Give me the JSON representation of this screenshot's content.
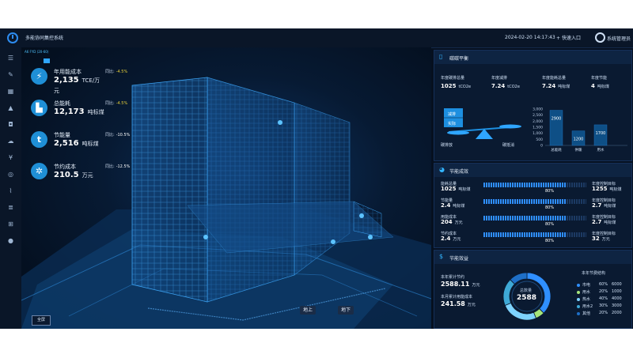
{
  "app": {
    "title": "多能协同集控系统",
    "datetime": "2024-02-20 14:17:43",
    "quick_entry": "快速入口",
    "admin": "系统管理员"
  },
  "sidebar": {
    "icons": [
      "menu-icon",
      "edit-icon",
      "grid-icon",
      "alert-icon",
      "box-icon",
      "cloud-icon",
      "yen-icon",
      "target-icon",
      "chart-line-icon",
      "settings-icon",
      "windows-icon",
      "user-icon"
    ]
  },
  "scene": {
    "floor_tag": "A6 FYD (20-60)",
    "fullscreen_label": "全屏",
    "above_ground_label": "地上",
    "below_ground_label": "地下"
  },
  "stats": [
    {
      "icon": "lightning-icon",
      "glyph": "⚡",
      "label": "年用能成本",
      "value": "2,135",
      "unit": "TCE/万",
      "unit2": "元",
      "ratio_label": "同比:",
      "ratio": "-4.5%",
      "ratio_color": "#e6cf3a"
    },
    {
      "icon": "factory-icon",
      "glyph": "▙",
      "label": "总能耗",
      "value": "12,173",
      "unit": "吨标煤",
      "unit2": "",
      "ratio_label": "同比:",
      "ratio": "-4.5%",
      "ratio_color": "#e6cf3a"
    },
    {
      "icon": "leaf-icon",
      "glyph": "t",
      "label": "节能量",
      "value": "2,516",
      "unit": "吨标煤",
      "unit2": "",
      "ratio_label": "同比:",
      "ratio": "-10.5%",
      "ratio_color": "#ffffff"
    },
    {
      "icon": "snowflake-icon",
      "glyph": "✲",
      "label": "节约成本",
      "value": "210.5",
      "unit": "万元",
      "unit2": "",
      "ratio_label": "同比:",
      "ratio": "-12.5%",
      "ratio_color": "#ffffff"
    }
  ],
  "carbon_panel": {
    "title": "碳碳平衡",
    "metrics": [
      {
        "label": "年度碳排总量",
        "value": "1025",
        "unit": "tCO2e"
      },
      {
        "label": "年度减排",
        "value": "7.24",
        "unit": "tCO2e"
      },
      {
        "label": "年度能耗总量",
        "value": "7.24",
        "unit": "吨标煤"
      },
      {
        "label": "年度节能",
        "value": "4",
        "unit": "吨标煤"
      }
    ],
    "balance": {
      "box_top": "减排",
      "box_bottom": "实际",
      "left_label": "碳排放",
      "right_label": "碳抵消"
    },
    "chart_data": {
      "type": "bar",
      "categories": [
        "总能耗",
        "供暖",
        "用水"
      ],
      "values": [
        2900,
        1200,
        1700
      ],
      "ylim": [
        0,
        3000
      ],
      "yticks": [
        "3,000",
        "2,500",
        "2,000",
        "1,500",
        "1,000",
        "500",
        "0"
      ],
      "bar_color": "#0e4f86"
    }
  },
  "saving_panel": {
    "title": "节能成效",
    "rows": [
      {
        "label": "能耗总量",
        "value": "1025",
        "unit": "吨标煤",
        "percent": "80%",
        "fill": 0.8,
        "target_label": "年度控制目标",
        "target_value": "1255",
        "target_unit": "吨标煤"
      },
      {
        "label": "节能量",
        "value": "2.4",
        "unit": "吨标煤",
        "percent": "80%",
        "fill": 0.8,
        "target_label": "年度控制目标",
        "target_value": "2.7",
        "target_unit": "吨标煤"
      },
      {
        "label": "用能成本",
        "value": "204",
        "unit": "万元",
        "percent": "80%",
        "fill": 0.8,
        "target_label": "年度控制目标",
        "target_value": "2.7",
        "target_unit": "吨标煤"
      },
      {
        "label": "节约成本",
        "value": "2.4",
        "unit": "万元",
        "percent": "80%",
        "fill": 0.8,
        "target_label": "年度控制目标",
        "target_value": "32",
        "target_unit": "万元"
      }
    ]
  },
  "benefit_panel": {
    "title": "节能效益",
    "yearly_label": "本年累计节约",
    "yearly_value": "2588.11",
    "yearly_unit": "万元",
    "monthly_label": "本月累计用能成本",
    "monthly_value": "241.58",
    "monthly_unit": "万元",
    "donut_label": "总数量",
    "donut_value": "2588",
    "legend_title": "本年节费结构",
    "chart_data": {
      "type": "pie",
      "labels": [
        "市电",
        "用水",
        "热水",
        "用水2",
        "其他"
      ],
      "percents": [
        60,
        20,
        40,
        30,
        20
      ],
      "values": [
        6000,
        1000,
        4000,
        3000,
        2000
      ],
      "percent_labels": [
        "60%",
        "20%",
        "40%",
        "30%",
        "20%"
      ],
      "value_labels": [
        "6000",
        "1000",
        "4000",
        "3000",
        "2000"
      ],
      "colors": [
        "#2f8fff",
        "#a6e57a",
        "#7ed3ff",
        "#3ea9d6",
        "#1e6fc7"
      ]
    }
  }
}
